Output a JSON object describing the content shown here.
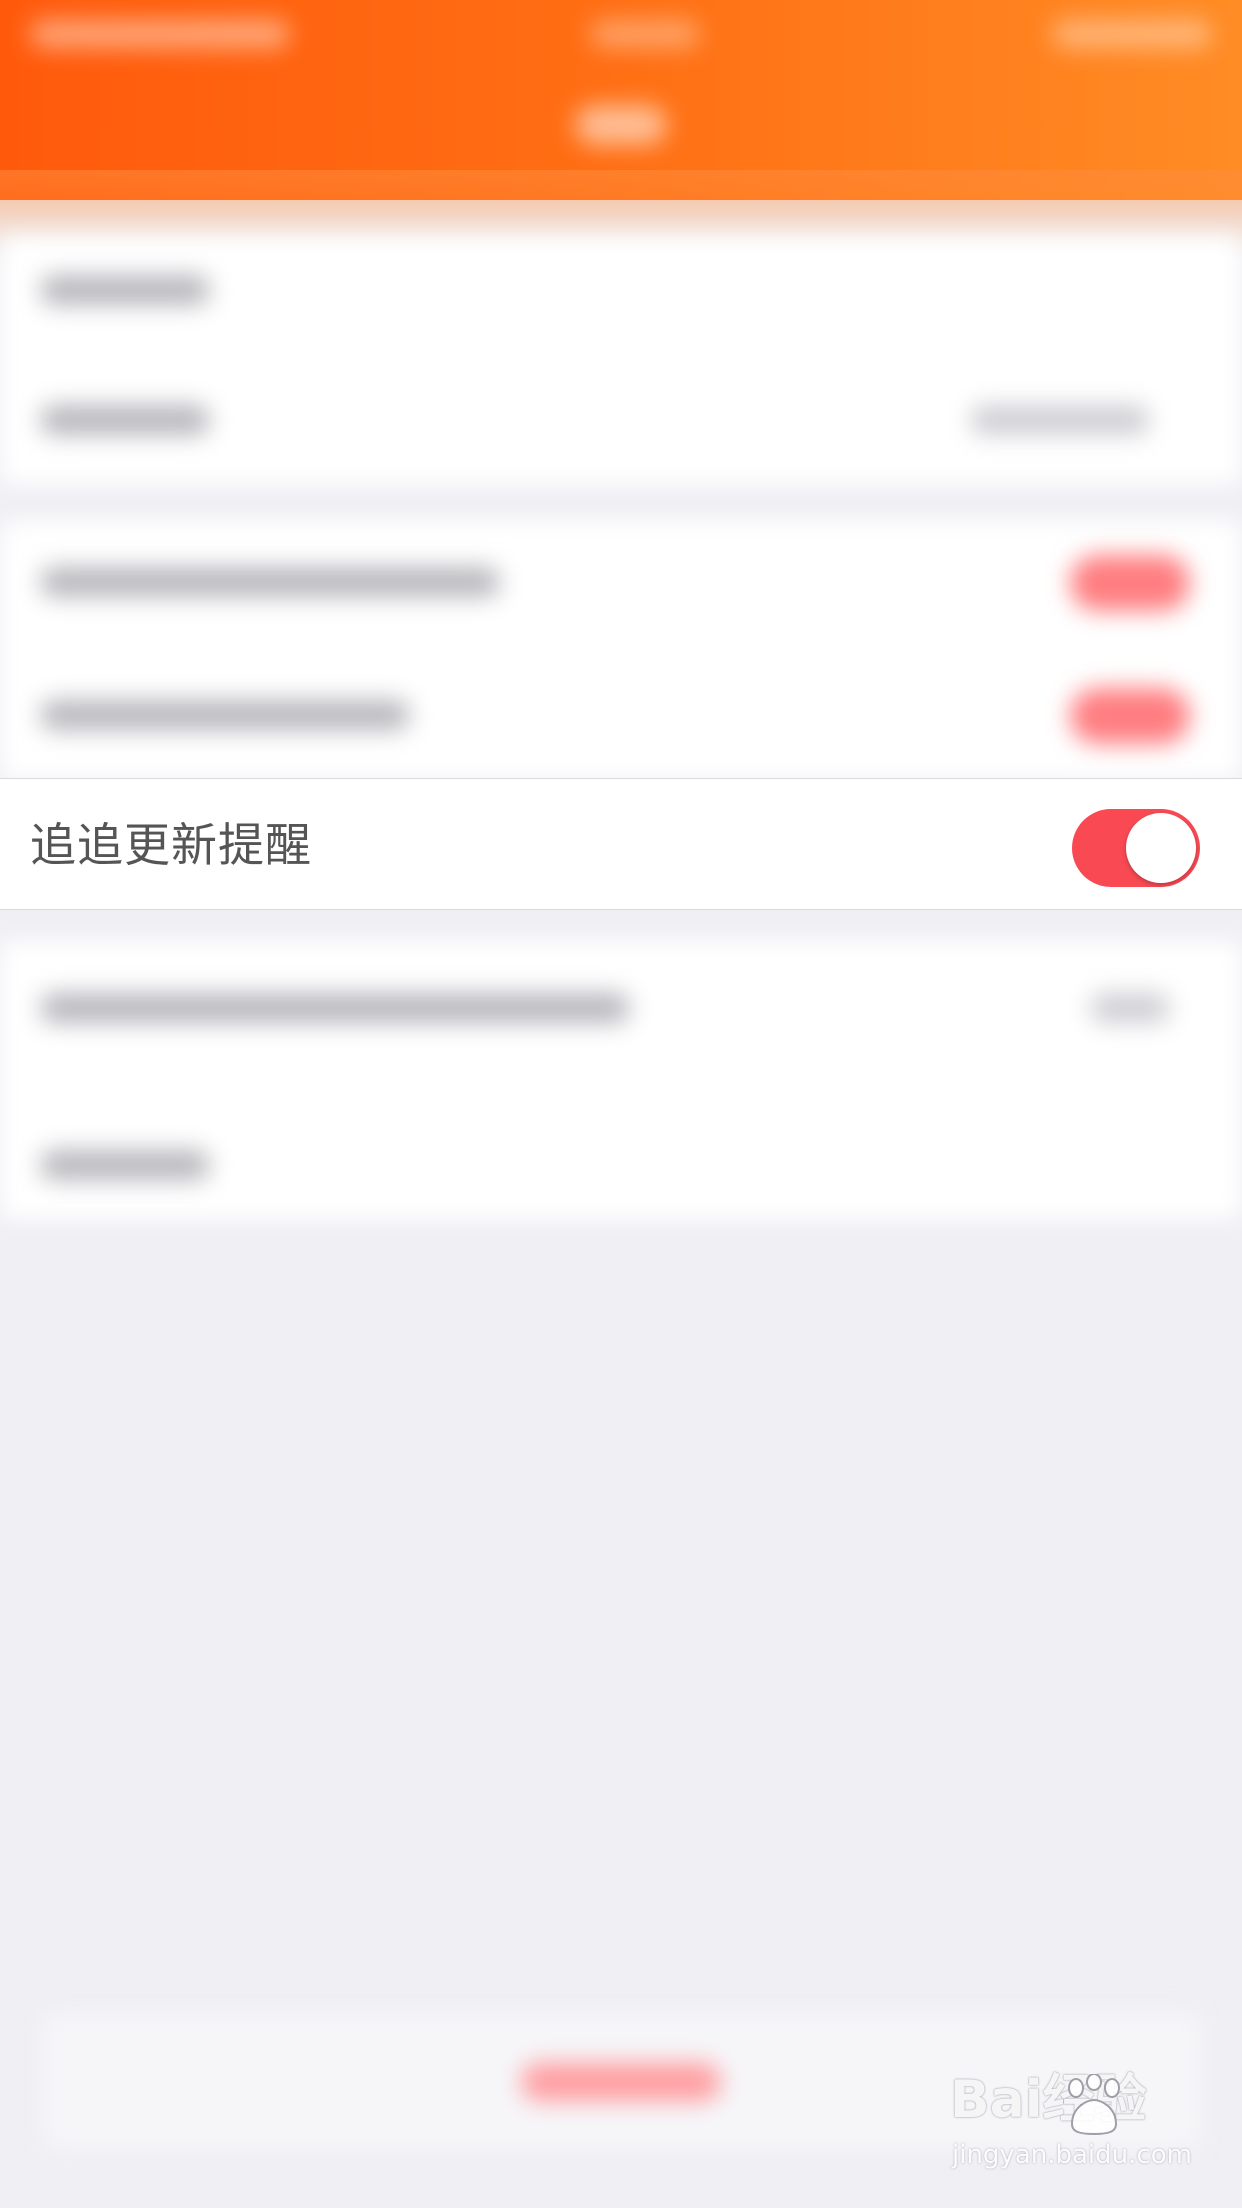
{
  "settings": {
    "update_reminder": {
      "label": "追追更新提醒",
      "enabled": true
    }
  },
  "watermark": {
    "logo_text": "Bai经验",
    "url": "jingyan.baidu.com"
  },
  "colors": {
    "header_start": "#ff5a0c",
    "header_end": "#ff8c25",
    "toggle_on": "#f94a53",
    "background": "#efeff4"
  }
}
